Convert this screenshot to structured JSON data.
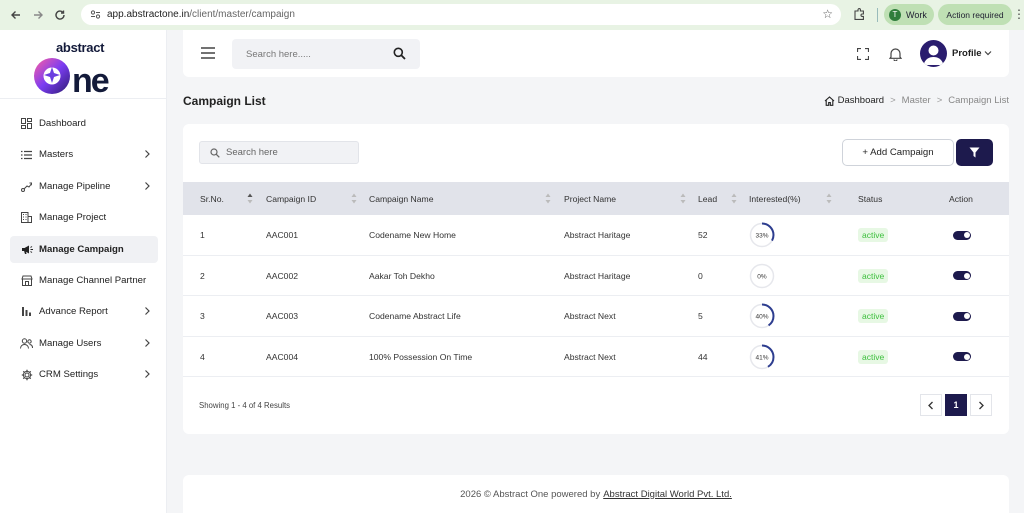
{
  "browser": {
    "url_host": "app.abstractone.in",
    "url_path": "/client/master/campaign",
    "profile_badge": "Work",
    "profile_initial": "T",
    "action_required": "Action required"
  },
  "sidebar": {
    "brand_top": "abstract",
    "brand_bottom": "one",
    "items": [
      {
        "label": "Dashboard",
        "icon": "dashboard-icon",
        "chevron": false
      },
      {
        "label": "Masters",
        "icon": "list-icon",
        "chevron": true
      },
      {
        "label": "Manage Pipeline",
        "icon": "pipeline-icon",
        "chevron": true
      },
      {
        "label": "Manage Project",
        "icon": "building-icon",
        "chevron": false
      },
      {
        "label": "Manage Campaign",
        "icon": "megaphone-icon",
        "chevron": false,
        "active": true
      },
      {
        "label": "Manage Channel Partner",
        "icon": "store-icon",
        "chevron": false
      },
      {
        "label": "Advance Report",
        "icon": "bar-chart-icon",
        "chevron": true
      },
      {
        "label": "Manage Users",
        "icon": "users-icon",
        "chevron": true
      },
      {
        "label": "CRM Settings",
        "icon": "gear-icon",
        "chevron": true
      }
    ]
  },
  "header": {
    "search_placeholder": "Search here.....",
    "profile_label": "Profile"
  },
  "page": {
    "title": "Campaign List",
    "breadcrumb": [
      "Dashboard",
      "Master",
      "Campaign List"
    ]
  },
  "table": {
    "search_placeholder": "Search here",
    "add_button": "+ Add Campaign",
    "columns": [
      "Sr.No.",
      "Campaign ID",
      "Campaign Name",
      "Project Name",
      "Lead",
      "Interested(%)",
      "Status",
      "Action"
    ],
    "rows": [
      {
        "sr": "1",
        "id": "AAC001",
        "name": "Codename New Home",
        "project": "Abstract Haritage",
        "lead": "52",
        "interested": 33,
        "interested_label": "33%",
        "status": "active"
      },
      {
        "sr": "2",
        "id": "AAC002",
        "name": "Aakar Toh Dekho",
        "project": "Abstract Haritage",
        "lead": "0",
        "interested": 0,
        "interested_label": "0%",
        "status": "active"
      },
      {
        "sr": "3",
        "id": "AAC003",
        "name": "Codename Abstract Life",
        "project": "Abstract Next",
        "lead": "5",
        "interested": 40,
        "interested_label": "40%",
        "status": "active"
      },
      {
        "sr": "4",
        "id": "AAC004",
        "name": "100% Possession On Time",
        "project": "Abstract Next",
        "lead": "44",
        "interested": 41,
        "interested_label": "41%",
        "status": "active"
      }
    ],
    "showing": "Showing 1 - 4 of 4 Results",
    "current_page": "1"
  },
  "footer": {
    "text": "2026 © Abstract One powered by",
    "link": "Abstract Digital World Pvt. Ltd."
  },
  "colors": {
    "brand": "#1d1a4d",
    "ring": "#2d3d8f",
    "active_green": "#3bbf3b",
    "chrome": "#e8f3e4"
  }
}
